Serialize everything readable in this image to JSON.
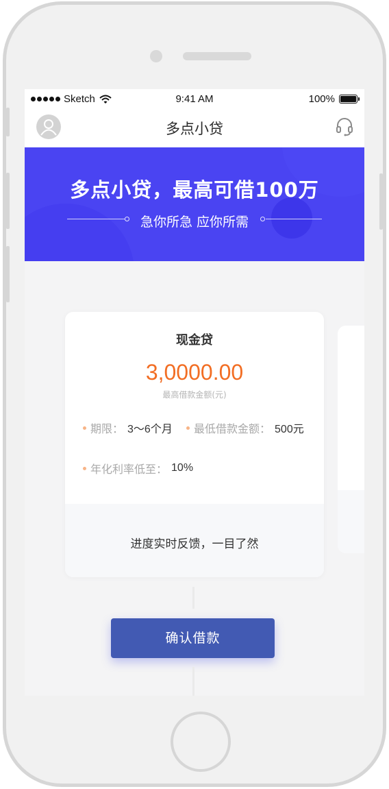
{
  "status_bar": {
    "carrier": "Sketch",
    "time": "9:41 AM",
    "battery": "100%",
    "battery_level": 1.0
  },
  "nav": {
    "title": "多点小贷",
    "left_icon": "user-avatar-icon",
    "right_icon": "headset-icon"
  },
  "banner": {
    "title": "多点小贷，最高可借100万",
    "subtitle": "急你所急 应你所需",
    "color": "#4a44f2"
  },
  "card": {
    "title": "现金贷",
    "amount": "3,0000.00",
    "amount_label": "最高借款金额(元)",
    "details": [
      {
        "label": "期限：",
        "value": "3～6个月"
      },
      {
        "label": "最低借款金额：",
        "value": "500元"
      },
      {
        "label": "年化利率低至：",
        "value": "10%"
      }
    ],
    "footer": "进度实时反馈，一目了然"
  },
  "confirm_button": {
    "label": "确认借款",
    "color": "#425ab3"
  },
  "colors": {
    "amount": "#f26e24",
    "bullet": "#f7b487"
  }
}
